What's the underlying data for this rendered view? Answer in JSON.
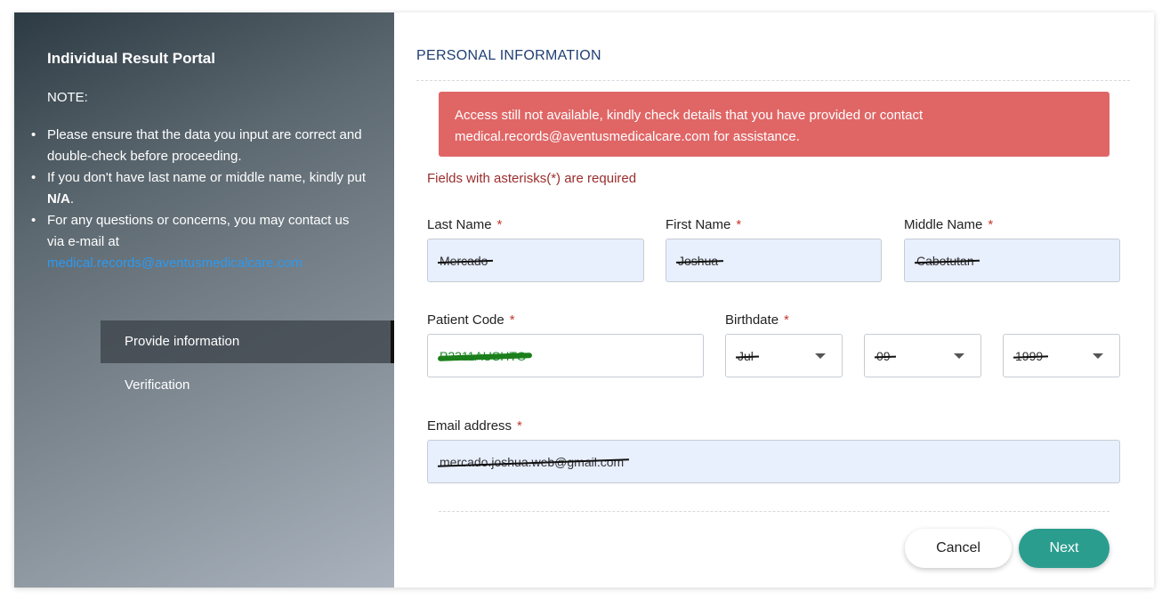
{
  "sidebar": {
    "title": "Individual Result Portal",
    "note_label": "NOTE:",
    "notes": {
      "n1": "Please ensure that the data you input are correct and double-check before proceeding.",
      "n2_prefix": "If you don't have last name or middle name, kindly put ",
      "n2_bold": "N/A",
      "n2_suffix": ".",
      "n3": "For any questions or concerns, you may contact us via e-mail at",
      "n3_email": "medical.records@aventusmedicalcare.com"
    },
    "steps": [
      {
        "label": "Provide information",
        "active": true
      },
      {
        "label": "Verification",
        "active": false
      }
    ]
  },
  "form": {
    "section_title": "PERSONAL INFORMATION",
    "alert": "Access still not available, kindly check details that you have provided or contact medical.records@aventusmedicalcare.com for assistance.",
    "required_note": "Fields with asterisks(*) are required",
    "asterisk": "*",
    "last_name": {
      "label": "Last Name",
      "value": "Mercado"
    },
    "first_name": {
      "label": "First Name",
      "value": "Joshua"
    },
    "middle_name": {
      "label": "Middle Name",
      "value": "Cabotutan"
    },
    "patient_code": {
      "label": "Patient Code",
      "value": "P2311AUSHTO"
    },
    "birthdate": {
      "label": "Birthdate",
      "day": "Jul",
      "month": "09",
      "year": "1999"
    },
    "email": {
      "label": "Email address",
      "value": "mercado.joshua.web@gmail.com"
    }
  },
  "buttons": {
    "cancel": "Cancel",
    "next": "Next"
  },
  "colors": {
    "alert_bg": "#e06666",
    "next_bg": "#2a9d8f",
    "title": "#1f3f73",
    "required_note": "#9b2d2d"
  }
}
